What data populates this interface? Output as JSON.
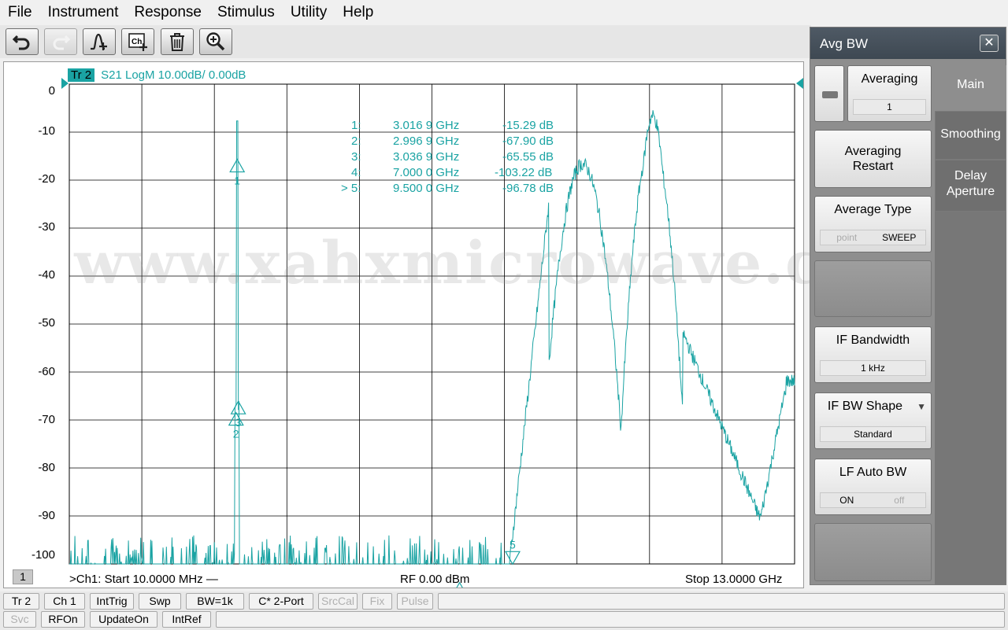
{
  "menu": [
    "File",
    "Instrument",
    "Response",
    "Stimulus",
    "Utility",
    "Help"
  ],
  "toolbar": {
    "buttons": [
      {
        "name": "undo-button",
        "icon": "undo-icon"
      },
      {
        "name": "redo-button",
        "icon": "redo-icon"
      },
      {
        "name": "add-marker-button",
        "icon": "marker-add-icon"
      },
      {
        "name": "add-channel-button",
        "icon": "channel-add-icon"
      },
      {
        "name": "delete-button",
        "icon": "trash-icon"
      },
      {
        "name": "zoom-button",
        "icon": "zoom-icon"
      }
    ]
  },
  "trace": {
    "badge": "Tr 2",
    "label": "S21 LogM 10.00dB/  0.00dB",
    "color": "#1aa3a3"
  },
  "y_ticks": [
    "0",
    "-10",
    "-20",
    "-30",
    "-40",
    "-50",
    "-60",
    "-70",
    "-80",
    "-90",
    "-100"
  ],
  "markers": [
    {
      "num": "1:",
      "freq": "3.016 9 GHz",
      "val": "-15.29 dB"
    },
    {
      "num": "2:",
      "freq": "2.996 9 GHz",
      "val": "-67.90 dB"
    },
    {
      "num": "3:",
      "freq": "3.036 9 GHz",
      "val": "-65.55 dB"
    },
    {
      "num": "4:",
      "freq": "7.000 0 GHz",
      "val": "-103.22 dB"
    },
    {
      "num": "> 5:",
      "freq": "9.500 0 GHz",
      "val": "-96.78 dB"
    }
  ],
  "watermark": "www.xahxmicrowave.com",
  "status": {
    "channel_num": "1",
    "start": ">Ch1:  Start  10.0000 MHz —",
    "rf": "RF    0.00 dBm",
    "stop": "Stop  13.0000 GHz"
  },
  "statusbar_row1": [
    {
      "label": "Tr 2",
      "disabled": false
    },
    {
      "label": "Ch 1",
      "disabled": false
    },
    {
      "label": "IntTrig",
      "disabled": false
    },
    {
      "label": "Swp",
      "disabled": false
    },
    {
      "label": "BW=1k",
      "disabled": false
    },
    {
      "label": "C* 2-Port",
      "disabled": false
    },
    {
      "label": "SrcCal",
      "disabled": true
    },
    {
      "label": "Fix",
      "disabled": true
    },
    {
      "label": "Pulse",
      "disabled": true
    }
  ],
  "statusbar_row2": [
    {
      "label": "Svc",
      "disabled": true
    },
    {
      "label": "RFOn",
      "disabled": false
    },
    {
      "label": "UpdateOn",
      "disabled": false
    },
    {
      "label": "IntRef",
      "disabled": false
    }
  ],
  "panel": {
    "title": "Avg BW",
    "close": "✕",
    "averaging": {
      "label": "Averaging",
      "value": "1"
    },
    "averaging_restart": "Averaging\nRestart",
    "average_type": {
      "label": "Average Type",
      "options": [
        "point",
        "SWEEP"
      ],
      "selected": "SWEEP"
    },
    "if_bandwidth": {
      "label": "IF Bandwidth",
      "value": "1 kHz"
    },
    "if_bw_shape": {
      "label": "IF BW Shape",
      "value": "Standard",
      "arrow": "▼"
    },
    "lf_auto_bw": {
      "label": "LF Auto BW",
      "options": [
        "ON",
        "off"
      ],
      "selected": "ON"
    },
    "tabs": [
      "Main",
      "Smoothing",
      "Delay\nAperture"
    ]
  }
}
